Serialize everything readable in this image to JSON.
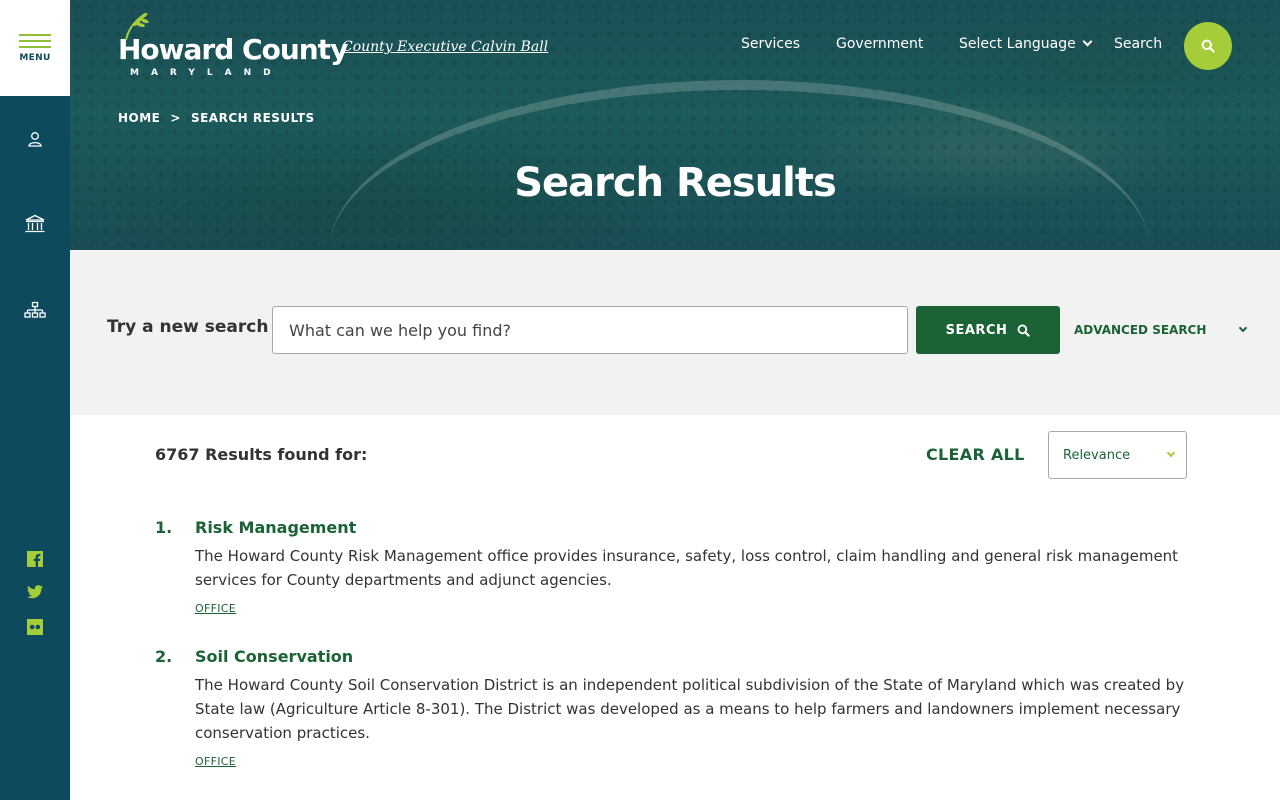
{
  "rail": {
    "menu_label": "MENU"
  },
  "header": {
    "logo_name": "Howard County",
    "logo_state": "MARYLAND",
    "exec_link": "County Executive Calvin Ball",
    "nav": {
      "services": "Services",
      "government": "Government",
      "language": "Select Language",
      "search": "Search"
    }
  },
  "breadcrumb": {
    "home": "HOME",
    "separator": ">",
    "current": "SEARCH RESULTS"
  },
  "page_title": "Search Results",
  "search": {
    "label": "Try a new search",
    "placeholder": "What can we help you find?",
    "button_label": "SEARCH",
    "advanced_label": "ADVANCED SEARCH"
  },
  "results": {
    "count_text": "6767 Results found for:",
    "clear_all": "CLEAR ALL",
    "sort_value": "Relevance",
    "items": [
      {
        "number": "1.",
        "title": "Risk Management",
        "description": "The Howard County Risk Management office provides insurance, safety, loss control, claim handling and general risk management services for County departments and adjunct agencies.",
        "tag": "OFFICE"
      },
      {
        "number": "2.",
        "title": "Soil Conservation",
        "description": "The Howard County Soil Conservation District is an independent political subdivision of the State of Maryland which was created by State law (Agriculture Article 8-301). The District was developed as a means to help farmers and landowners implement necessary conservation practices.",
        "tag": "OFFICE"
      }
    ]
  },
  "colors": {
    "rail": "#0d4a5e",
    "brand_green": "#1b6336",
    "accent_lime": "#a4cd39",
    "band_gray": "#f2f2f2"
  },
  "icons": {
    "rail": [
      "person-icon",
      "government-building-icon",
      "org-chart-icon"
    ],
    "social": [
      "facebook-icon",
      "twitter-icon",
      "flickr-icon"
    ],
    "search": "search-icon"
  }
}
